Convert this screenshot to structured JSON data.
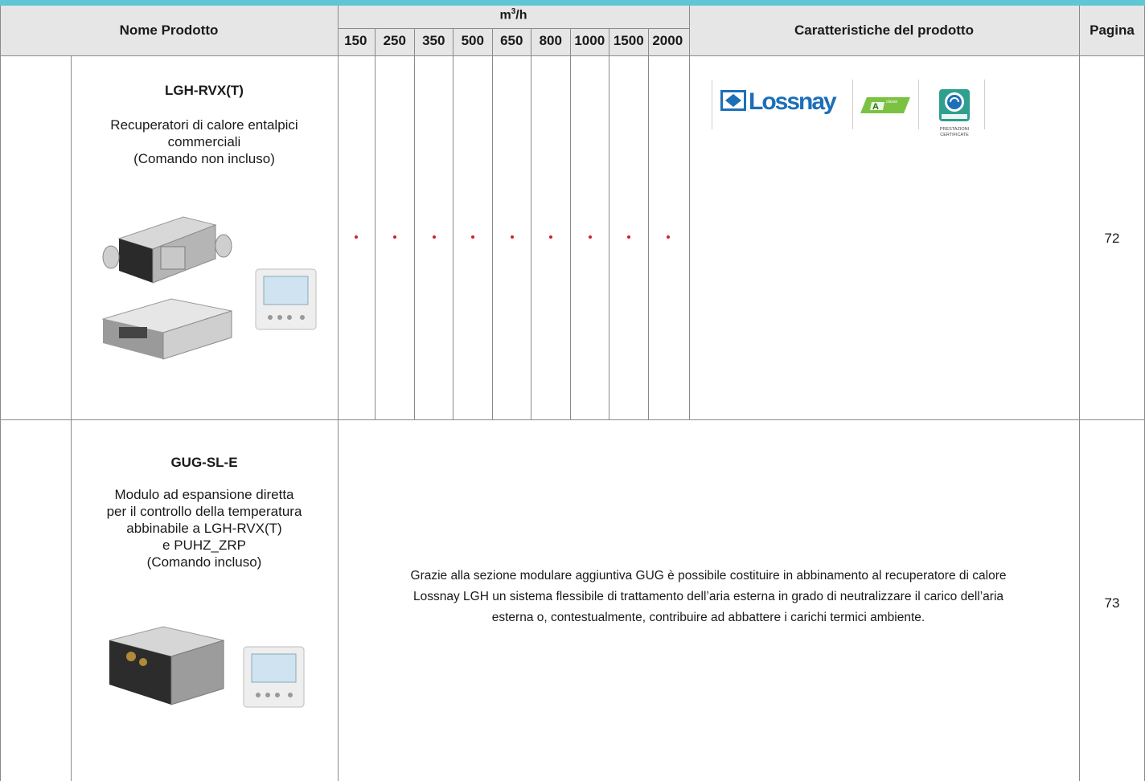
{
  "header": {
    "name_label": "Nome Prodotto",
    "flow_unit": "m",
    "flow_unit_sup": "3",
    "flow_unit_suffix": "/h",
    "flow_values": [
      "150",
      "250",
      "350",
      "500",
      "650",
      "800",
      "1000",
      "1500",
      "2000"
    ],
    "features_label": "Caratteristiche del prodotto",
    "page_label": "Pagina"
  },
  "products": [
    {
      "title": "LGH-RVX(T)",
      "description": [
        "Recuperatori di calore entalpici",
        "commerciali",
        "(Comando non incluso)"
      ],
      "page": "72",
      "logos": {
        "lossnay": "Lossnay",
        "energy_class_letter": "A",
        "energy_class_word": "classe",
        "cert_top": "PRESTAZIONI",
        "cert_bottom": "CERTIFICATE"
      },
      "flow_marks": [
        true,
        true,
        true,
        true,
        true,
        true,
        true,
        true,
        true
      ]
    },
    {
      "title": "GUG-SL-E",
      "description": [
        "Modulo ad espansione diretta",
        "per il controllo della temperatura",
        "abbinabile a LGH-RVX(T)",
        "e PUHZ_ZRP",
        "(Comando incluso)"
      ],
      "page": "73",
      "features_text": [
        "Grazie alla sezione modulare aggiuntiva GUG è possibile costituire in abbinamento al recuperatore di calore",
        "Lossnay LGH un sistema flessibile di trattamento dell’aria esterna in grado di neutralizzare il carico dell’aria",
        "esterna o, contestualmente, contribuire ad abbattere i carichi termici ambiente."
      ]
    }
  ],
  "colors": {
    "accent_strip": "#5fc6d3",
    "header_bg": "#e6e6e6",
    "dot": "#d0202a",
    "lossnay_blue": "#1d6fb8",
    "energy_green": "#7cc242"
  }
}
